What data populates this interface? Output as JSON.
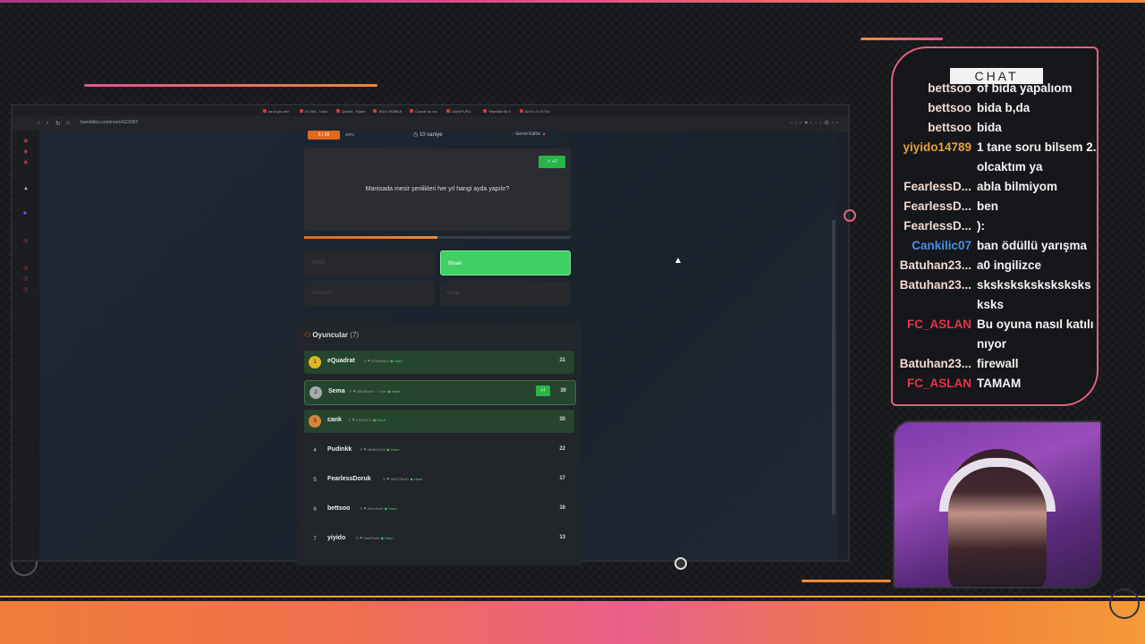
{
  "browser": {
    "tabs": [
      "sa ki için ann",
      "En İlkit - Turke",
      "Quizbit - Eğlen",
      "JEUX MOBILE",
      "Couple du mo",
      "LikeUPUFU",
      "Yeşetilse Bir li",
      "Bir Ev Tİ Ol Tür"
    ],
    "url": "bambidoo.com/room/GOVBY"
  },
  "quiz": {
    "progress": "5 / 20",
    "progress_word": "soru",
    "time": "10",
    "time_unit": "saniye",
    "category": "Genel Kültür",
    "points_badge": "+7",
    "question": "Manisada mesir şenlikleri her yıl hangi ayda yapılır?",
    "timer_fraction": 0.5,
    "answers": [
      {
        "label": "Aralık",
        "state": "dim"
      },
      {
        "label": "Nisan",
        "state": "correct"
      },
      {
        "label": "Temmuz",
        "state": "dim"
      },
      {
        "label": "Ocak",
        "state": "dim"
      }
    ]
  },
  "players": {
    "title": "Oyuncular",
    "count": "(7)",
    "list": [
      {
        "rank": "1",
        "name": "eQuadrat",
        "id": "#93d99ac3",
        "status": "Hazır",
        "score": "31",
        "gain": "",
        "medal": "#e3b627"
      },
      {
        "rank": "2",
        "name": "Sema",
        "id": "#8b4Fa4e7",
        "extra": "Sen",
        "status": "Hazır",
        "score": "30",
        "gain": "+7",
        "medal": "#a7a9ad"
      },
      {
        "rank": "3",
        "name": "cank",
        "id": "#7883270",
        "status": "Hazır",
        "score": "30",
        "gain": "",
        "medal": "#d9843e"
      },
      {
        "rank": "4",
        "name": "Pudinkk",
        "id": "#8d6e1344",
        "status": "Hazır",
        "score": "22",
        "gain": ""
      },
      {
        "rank": "5",
        "name": "FearlessDoruk",
        "id": "#6577Ba21",
        "status": "Hazır",
        "score": "17",
        "gain": ""
      },
      {
        "rank": "6",
        "name": "bettsoo",
        "id": "#54e4cd4",
        "status": "Hazır",
        "score": "16",
        "gain": ""
      },
      {
        "rank": "7",
        "name": "yiyido",
        "id": "#aeff1a4b",
        "status": "Hazır",
        "score": "13",
        "gain": ""
      }
    ]
  },
  "chat": {
    "title": "CHAT",
    "messages": [
      {
        "user": "bettsoo",
        "text": "of bida yapalıom",
        "color": "#f3d9d2"
      },
      {
        "user": "bettsoo",
        "text": "bida b,da",
        "color": "#f3d9d2"
      },
      {
        "user": "bettsoo",
        "text": "bida",
        "color": "#f3d9d2"
      },
      {
        "user": "yiyido14789",
        "text": "1 tane soru bilsem 2. olcaktım ya",
        "color": "#e6a03a"
      },
      {
        "user": "FearlessD...",
        "text": "abla bilmiyom",
        "color": "#f3d9d2"
      },
      {
        "user": "FearlessD...",
        "text": "ben",
        "color": "#f3d9d2"
      },
      {
        "user": "FearlessD...",
        "text": "):",
        "color": "#f3d9d2"
      },
      {
        "user": "Cankilic07",
        "text": "ban ödüllü yarışma",
        "color": "#4a90e2"
      },
      {
        "user": "Batuhan23...",
        "text": "a0 ingilizce",
        "color": "#f3d9d2"
      },
      {
        "user": "Batuhan23...",
        "text": "sksksksksksksksksksks",
        "color": "#f3d9d2"
      },
      {
        "user": "FC_ASLAN",
        "text": "Bu oyuna nasıl katılınıyor",
        "color": "#e8324a"
      },
      {
        "user": "Batuhan23...",
        "text": "firewall",
        "color": "#f3d9d2"
      },
      {
        "user": "FC_ASLAN",
        "text": "TAMAM",
        "color": "#e8324a"
      }
    ]
  }
}
